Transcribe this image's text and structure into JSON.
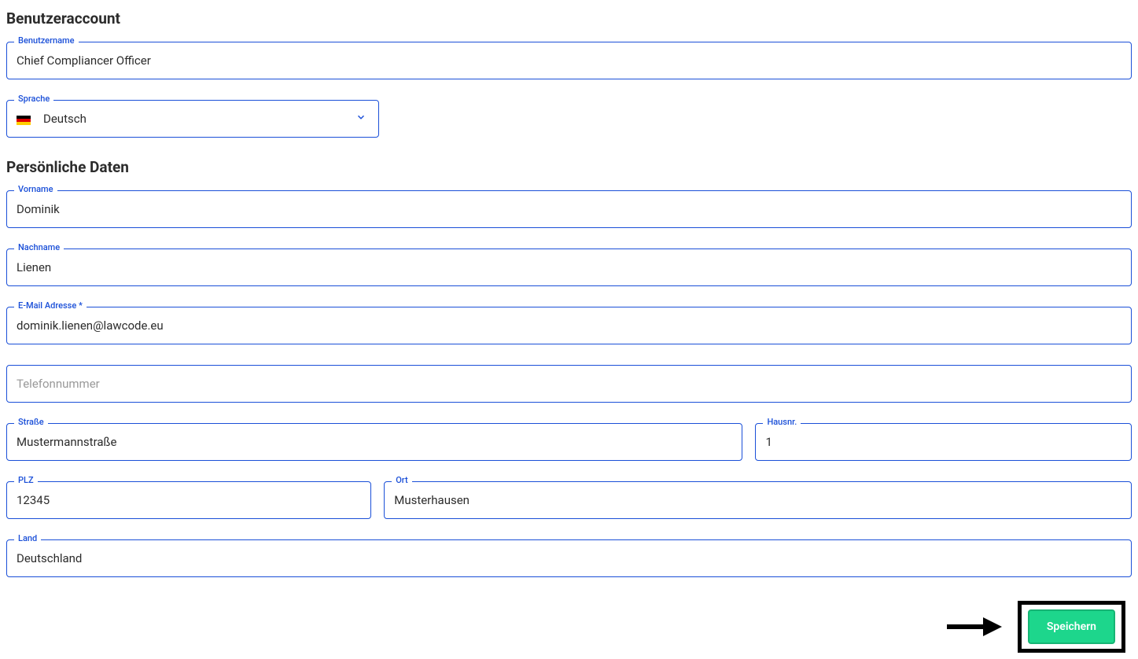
{
  "sections": {
    "account": {
      "title": "Benutzeraccount",
      "username": {
        "label": "Benutzername",
        "value": "Chief Compliancer Officer"
      },
      "language": {
        "label": "Sprache",
        "value": "Deutsch"
      }
    },
    "personal": {
      "title": "Persönliche Daten",
      "firstname": {
        "label": "Vorname",
        "value": "Dominik"
      },
      "lastname": {
        "label": "Nachname",
        "value": "Lienen"
      },
      "email": {
        "label": "E-Mail Adresse *",
        "value": "dominik.lienen@lawcode.eu"
      },
      "phone": {
        "placeholder": "Telefonnummer",
        "value": ""
      },
      "street": {
        "label": "Straße",
        "value": "Mustermannstraße"
      },
      "housenr": {
        "label": "Hausnr.",
        "value": "1"
      },
      "zip": {
        "label": "PLZ",
        "value": "12345"
      },
      "city": {
        "label": "Ort",
        "value": "Musterhausen"
      },
      "country": {
        "label": "Land",
        "value": "Deutschland"
      }
    }
  },
  "actions": {
    "save": "Speichern"
  }
}
